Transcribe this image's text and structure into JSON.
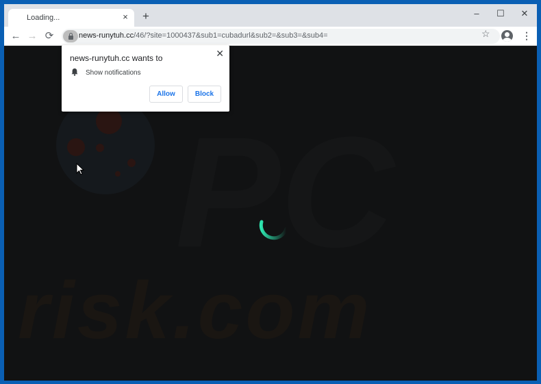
{
  "browser": {
    "tab": {
      "title": "Loading...",
      "close_glyph": "×"
    },
    "new_tab_glyph": "+",
    "window_controls": {
      "minimize": "–",
      "maximize": "☐",
      "close": "✕"
    },
    "nav": {
      "back": "←",
      "forward": "→",
      "reload": "⟳"
    },
    "url_host": "news-runytuh.cc",
    "url_path": "/46/?site=1000437&sub1=cubadurl&sub2=&sub3=&sub4=",
    "star_glyph": "☆",
    "menu_glyph": "⋮"
  },
  "popup": {
    "title": "news-runytuh.cc wants to",
    "permission": "Show notifications",
    "allow_label": "Allow",
    "block_label": "Block",
    "close_glyph": "✕",
    "accent_color": "#1a73e8"
  },
  "watermark": {
    "text": "risk.com",
    "logo": "PC"
  },
  "spinner": {
    "color": "#2ee6b0"
  }
}
